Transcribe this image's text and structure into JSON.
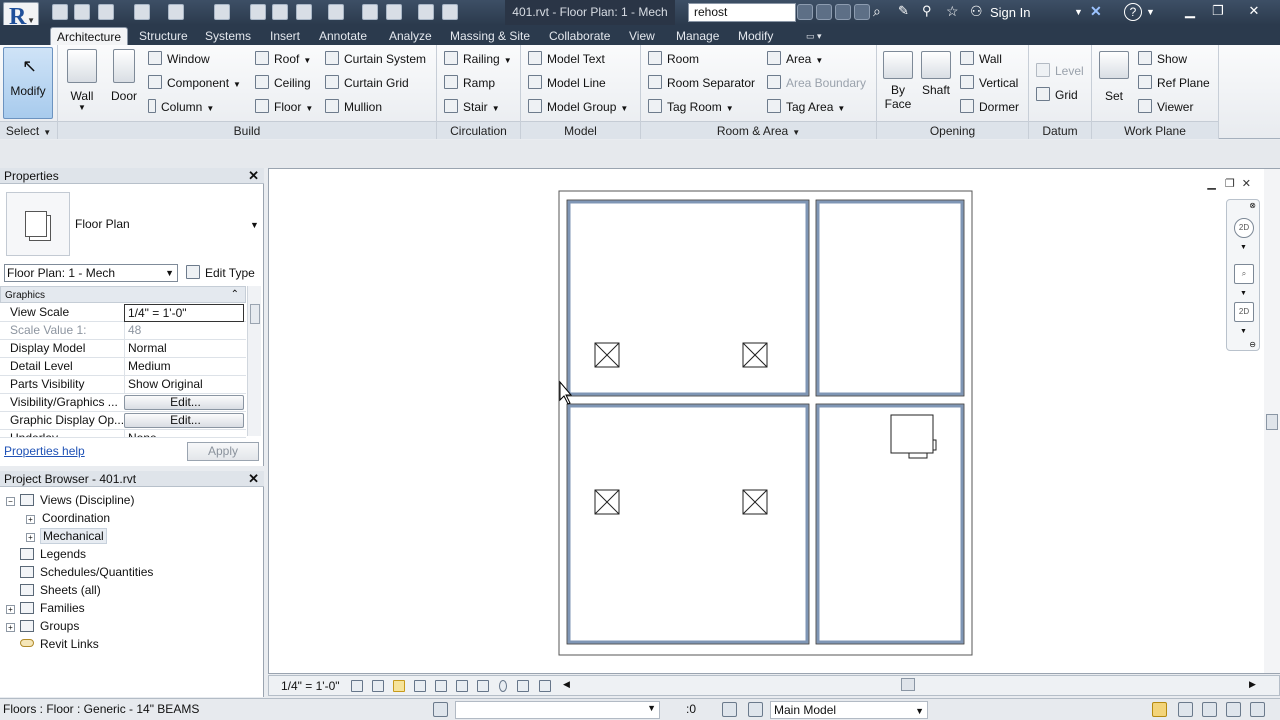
{
  "app": {
    "logo_letter": "R",
    "document_title": "401.rvt - Floor Plan: 1 - Mech",
    "search_value": "rehost",
    "sign_in_label": "Sign In"
  },
  "ribbon_tabs": [
    "Architecture",
    "Structure",
    "Systems",
    "Insert",
    "Annotate",
    "Analyze",
    "Massing & Site",
    "Collaborate",
    "View",
    "Manage",
    "Modify"
  ],
  "ribbon": {
    "select": {
      "modify_label": "Modify",
      "panel_label": "Select"
    },
    "build": {
      "panel_label": "Build",
      "wall": "Wall",
      "door": "Door",
      "window": "Window",
      "component": "Component",
      "column": "Column",
      "roof": "Roof",
      "ceiling": "Ceiling",
      "floor": "Floor",
      "curtain_system": "Curtain System",
      "curtain_grid": "Curtain Grid",
      "mullion": "Mullion"
    },
    "circulation": {
      "panel_label": "Circulation",
      "railing": "Railing",
      "ramp": "Ramp",
      "stair": "Stair"
    },
    "model": {
      "panel_label": "Model",
      "model_text": "Model Text",
      "model_line": "Model Line",
      "model_group": "Model Group"
    },
    "room_area": {
      "panel_label": "Room & Area",
      "room": "Room",
      "room_separator": "Room Separator",
      "tag_room": "Tag Room",
      "area": "Area",
      "area_boundary": "Area Boundary",
      "tag_area": "Tag Area"
    },
    "opening": {
      "panel_label": "Opening",
      "by_face_1": "By",
      "by_face_2": "Face",
      "shaft": "Shaft",
      "wall": "Wall",
      "vertical": "Vertical",
      "dormer": "Dormer"
    },
    "datum": {
      "panel_label": "Datum",
      "level": "Level",
      "grid": "Grid"
    },
    "work_plane": {
      "panel_label": "Work Plane",
      "set": "Set",
      "show": "Show",
      "ref_plane": "Ref Plane",
      "viewer": "Viewer"
    }
  },
  "properties": {
    "title": "Properties",
    "type_name": "Floor Plan",
    "instance": "Floor Plan: 1 - Mech",
    "edit_type": "Edit Type",
    "group": "Graphics",
    "rows": [
      {
        "key": "View Scale",
        "value": "1/4\" = 1'-0\""
      },
      {
        "key": "Scale Value    1:",
        "value": "48"
      },
      {
        "key": "Display Model",
        "value": "Normal"
      },
      {
        "key": "Detail Level",
        "value": "Medium"
      },
      {
        "key": "Parts Visibility",
        "value": "Show Original"
      },
      {
        "key": "Visibility/Graphics ...",
        "value": "Edit..."
      },
      {
        "key": "Graphic Display Op...",
        "value": "Edit..."
      },
      {
        "key": "Underlay",
        "value": "None"
      }
    ],
    "help": "Properties help",
    "apply": "Apply"
  },
  "browser": {
    "title": "Project Browser - 401.rvt",
    "items": [
      {
        "label": "Views (Discipline)",
        "expander": "−"
      },
      {
        "label": "Coordination",
        "expander": "+"
      },
      {
        "label": "Mechanical",
        "expander": "+"
      },
      {
        "label": "Legends",
        "expander": ""
      },
      {
        "label": "Schedules/Quantities",
        "expander": ""
      },
      {
        "label": "Sheets (all)",
        "expander": ""
      },
      {
        "label": "Families",
        "expander": "+"
      },
      {
        "label": "Groups",
        "expander": "+"
      },
      {
        "label": "Revit Links",
        "expander": ""
      }
    ]
  },
  "viewbar": {
    "scale": "1/4\" = 1'-0\""
  },
  "statusbar": {
    "text": "Floors : Floor : Generic - 14\" BEAMS",
    "counter": ":0",
    "model": "Main Model"
  },
  "colors": {
    "accent": "#1f4f9a",
    "wall_fill": "#8ea6c6",
    "ribbon_tab_bg": "#2b3a4d"
  },
  "icons": [
    "revit-logo-icon",
    "open-icon",
    "save-icon",
    "undo-icon",
    "redo-icon",
    "measure-icon",
    "text-icon",
    "3d-view-icon",
    "binoculars-icon",
    "star-icon",
    "user-icon",
    "exchange-icon",
    "help-icon",
    "modify-cursor-icon",
    "wall-icon",
    "door-icon",
    "close-icon",
    "zoom-icon",
    "2d-wheel-icon"
  ]
}
